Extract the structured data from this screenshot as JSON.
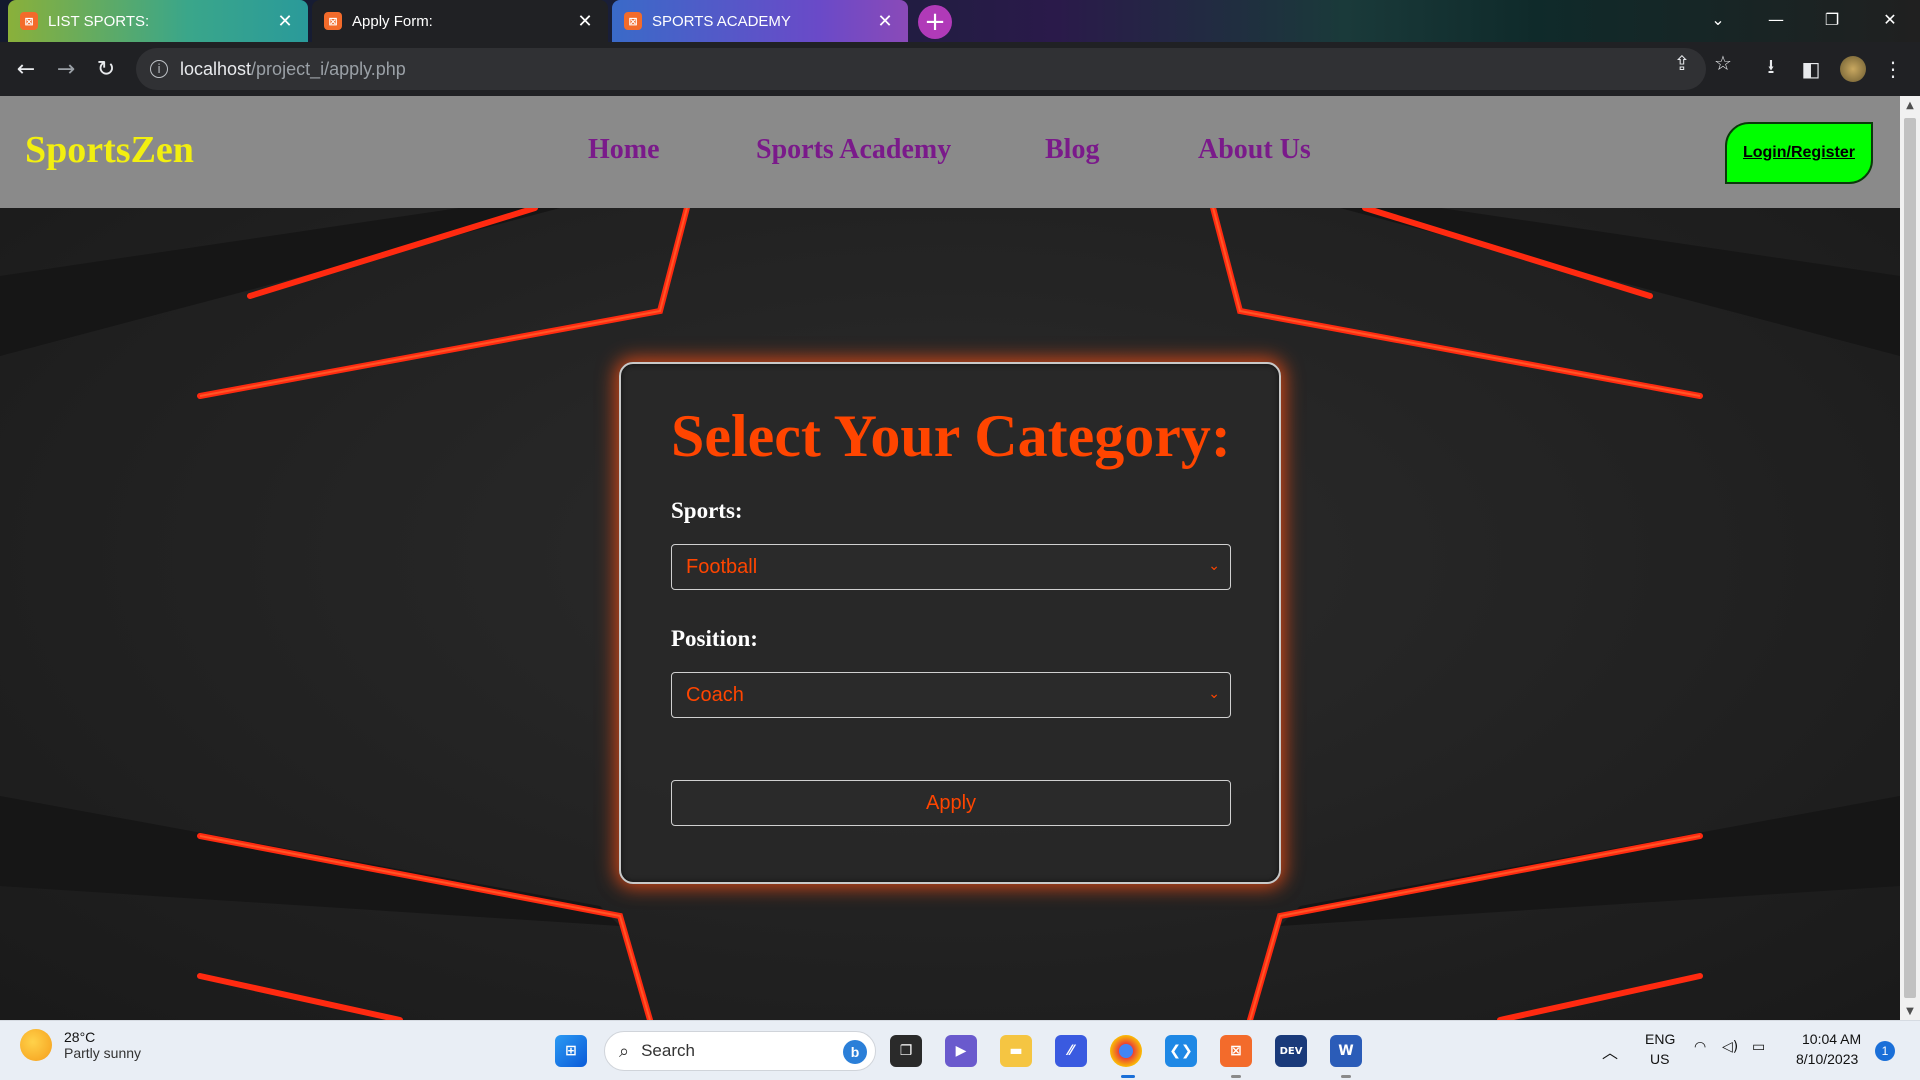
{
  "browser": {
    "tabs": [
      {
        "title": "LIST SPORTS:",
        "favicon": "xampp-icon"
      },
      {
        "title": "Apply Form:",
        "favicon": "xampp-icon"
      },
      {
        "title": "SPORTS ACADEMY",
        "favicon": "xampp-icon"
      }
    ],
    "address": {
      "host": "localhost",
      "path": "/project_i/apply.php"
    }
  },
  "site": {
    "logo": "SportsZen",
    "nav": [
      "Home",
      "Sports Academy",
      "Blog",
      "About Us"
    ],
    "login_label": "Login/Register",
    "colors": {
      "logo": "#f2ef10",
      "nav": "#7a1a8a",
      "login_bg": "#00ff00",
      "accent": "#ff4500",
      "navbar_bg": "#8a8a8a"
    }
  },
  "form": {
    "heading": "Select Your Category:",
    "sports_label": "Sports:",
    "sports_value": "Football",
    "position_label": "Position:",
    "position_value": "Coach",
    "apply_label": "Apply"
  },
  "taskbar": {
    "weather_temp": "28°C",
    "weather_cond": "Partly sunny",
    "search_placeholder": "Search",
    "lang_top": "ENG",
    "lang_bottom": "US",
    "time": "10:04 AM",
    "date": "8/10/2023",
    "notifications": "1",
    "apps": [
      "windows-start-icon",
      "task-view-icon",
      "teams-chat-icon",
      "file-explorer-icon",
      "vs-code-ai-icon",
      "chrome-icon",
      "vscode-icon",
      "xampp-icon",
      "dev-cpp-icon",
      "word-icon"
    ]
  }
}
